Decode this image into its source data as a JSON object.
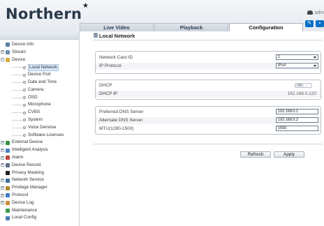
{
  "header": {
    "logo": "Northern",
    "logo_mark": "★",
    "user": "adm"
  },
  "tabs": [
    {
      "label": "Live Video",
      "active": false
    },
    {
      "label": "Playback",
      "active": false
    },
    {
      "label": "Configuration",
      "active": true
    }
  ],
  "sidebar": {
    "items": [
      {
        "label": "Device Info",
        "level": 1,
        "expander": "",
        "icon": "info-icon",
        "color": "#5a7fa8"
      },
      {
        "label": "Stream",
        "level": 1,
        "expander": "+",
        "icon": "stream-icon",
        "color": "#6b8db3"
      },
      {
        "label": "Device",
        "level": 1,
        "expander": "-",
        "icon": "folder-icon",
        "color": "#d9a93e"
      },
      {
        "label": "Local Network",
        "level": 2,
        "selected": true
      },
      {
        "label": "Device Port",
        "level": 2
      },
      {
        "label": "Date and Time",
        "level": 2
      },
      {
        "label": "Camera",
        "level": 2
      },
      {
        "label": "OSD",
        "level": 2
      },
      {
        "label": "Microphone",
        "level": 2
      },
      {
        "label": "CVBS",
        "level": 2
      },
      {
        "label": "System",
        "level": 2
      },
      {
        "label": "Voice Denoise",
        "level": 2
      },
      {
        "label": "Software Licenses",
        "level": 2
      },
      {
        "label": "External Device",
        "level": 1,
        "expander": "+",
        "icon": "external-device-icon",
        "color": "#3a8f4a"
      },
      {
        "label": "Intelligent Analysis",
        "level": 1,
        "expander": "+",
        "icon": "analysis-icon",
        "color": "#4b7fc2"
      },
      {
        "label": "Alarm",
        "level": 1,
        "expander": "+",
        "icon": "alarm-icon",
        "color": "#c04040"
      },
      {
        "label": "Device Record",
        "level": 1,
        "expander": "+",
        "icon": "record-icon",
        "color": "#5c6f84"
      },
      {
        "label": "Privacy Masking",
        "level": 1,
        "expander": "",
        "icon": "privacy-mask-icon",
        "color": "#222"
      },
      {
        "label": "Network Service",
        "level": 1,
        "expander": "+",
        "icon": "network-service-icon",
        "color": "#3a6fa3"
      },
      {
        "label": "Privilege Manager",
        "level": 1,
        "expander": "+",
        "icon": "privilege-icon",
        "color": "#b8862e"
      },
      {
        "label": "Protocol",
        "level": 1,
        "expander": "+",
        "icon": "protocol-icon",
        "color": "#3c7dbf"
      },
      {
        "label": "Device Log",
        "level": 1,
        "expander": "+",
        "icon": "log-icon",
        "color": "#d28b3a"
      },
      {
        "label": "Maintenance",
        "level": 1,
        "expander": "",
        "icon": "maintenance-icon",
        "color": "#3a9a4c"
      },
      {
        "label": "Local Config",
        "level": 1,
        "expander": "",
        "icon": "local-config-icon",
        "color": "#4a7fb8"
      }
    ]
  },
  "page": {
    "title": "Local Network",
    "network_card_label": "Network Card ID",
    "network_card_value": "1",
    "ip_protocol_label": "IP Protocol",
    "ip_protocol_value": "IPv4",
    "dhcp_label": "DHCP",
    "dhcp_toggle": "ON",
    "dhcp_ip_label": "DHCP IP",
    "dhcp_ip_value": "192.168.0.120",
    "preferred_dns_label": "Preferred DNS Server",
    "preferred_dns_value": "192.168.0.1",
    "alternate_dns_label": "Alternate DNS Server",
    "alternate_dns_value": "192.168.0.2",
    "mtu_label": "MTU(1280-1500)",
    "mtu_value": "1500",
    "refresh_label": "Refresh",
    "apply_label": "Apply"
  }
}
